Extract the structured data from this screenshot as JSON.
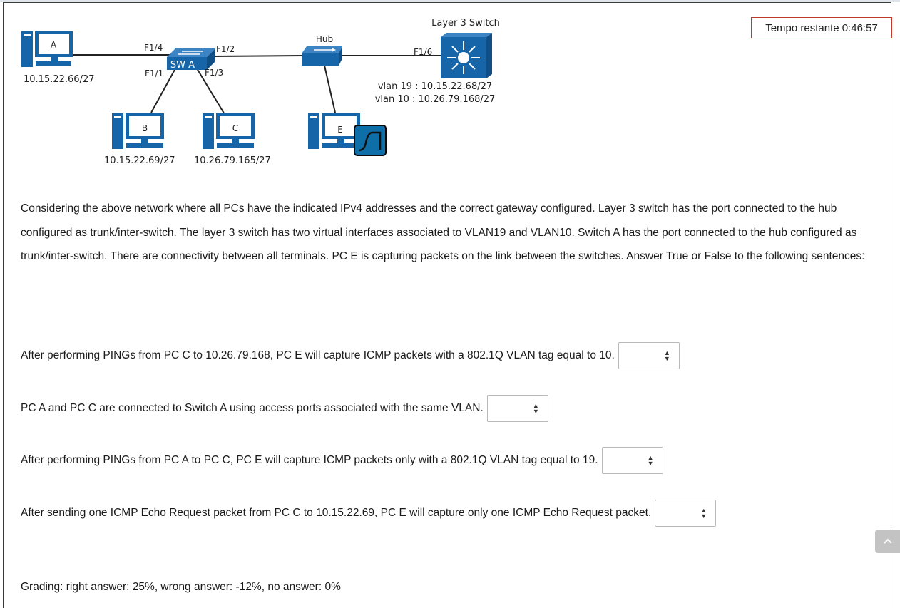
{
  "timer": {
    "text": "Tempo restante 0:46:57"
  },
  "diagram": {
    "pc_a": {
      "tag": "A",
      "ip": "10.15.22.66/27"
    },
    "pc_b": {
      "tag": "B",
      "ip": "10.15.22.69/27"
    },
    "pc_c": {
      "tag": "C",
      "ip": "10.26.79.165/27"
    },
    "pc_e": {
      "tag": "E"
    },
    "switch_a": {
      "label": "SW A"
    },
    "hub": {
      "label": "Hub"
    },
    "l3_switch": {
      "label": "Layer 3 Switch",
      "vlan19": "vlan 19 : 10.15.22.68/27",
      "vlan10": "vlan 10 : 10.26.79.168/27"
    },
    "ports": {
      "f14": "F1/4",
      "f11": "F1/1",
      "f12": "F1/2",
      "f13": "F1/3",
      "f16": "F1/6"
    }
  },
  "intro_text": "Considering the above network where all PCs have the indicated IPv4 addresses and the correct gateway configured. Layer 3 switch has the port connected to the hub configured as trunk/inter-switch. The layer 3 switch has two virtual interfaces associated to VLAN19 and VLAN10. Switch A has the port connected to the hub configured as trunk/inter-switch. There are connectivity between all terminals. PC E is capturing packets on the link between the switches. Answer True or False to the following sentences:",
  "questions": [
    {
      "text": "After performing PINGs from PC C to 10.26.79.168, PC E will capture ICMP packets with a 802.1Q VLAN tag equal to 10.",
      "selected": ""
    },
    {
      "text": "PC A and PC C are connected to Switch A using access ports associated with the same VLAN.",
      "selected": ""
    },
    {
      "text": "After performing PINGs from PC A to PC C, PC E will capture ICMP packets only with a 802.1Q VLAN tag equal to 19.",
      "selected": ""
    },
    {
      "text": "After sending one ICMP Echo Request packet from PC C to 10.15.22.69, PC E will capture only one ICMP Echo Request packet.",
      "selected": ""
    }
  ],
  "grading_text": "Grading: right answer: 25%, wrong answer: -12%, no answer: 0%",
  "icons": {
    "select_arrows": "updown-icon",
    "scroll_top": "chevron-up-icon",
    "wireshark": "wireshark-icon"
  },
  "colors": {
    "device_blue": "#1565a8",
    "timer_border": "#c0392b"
  }
}
